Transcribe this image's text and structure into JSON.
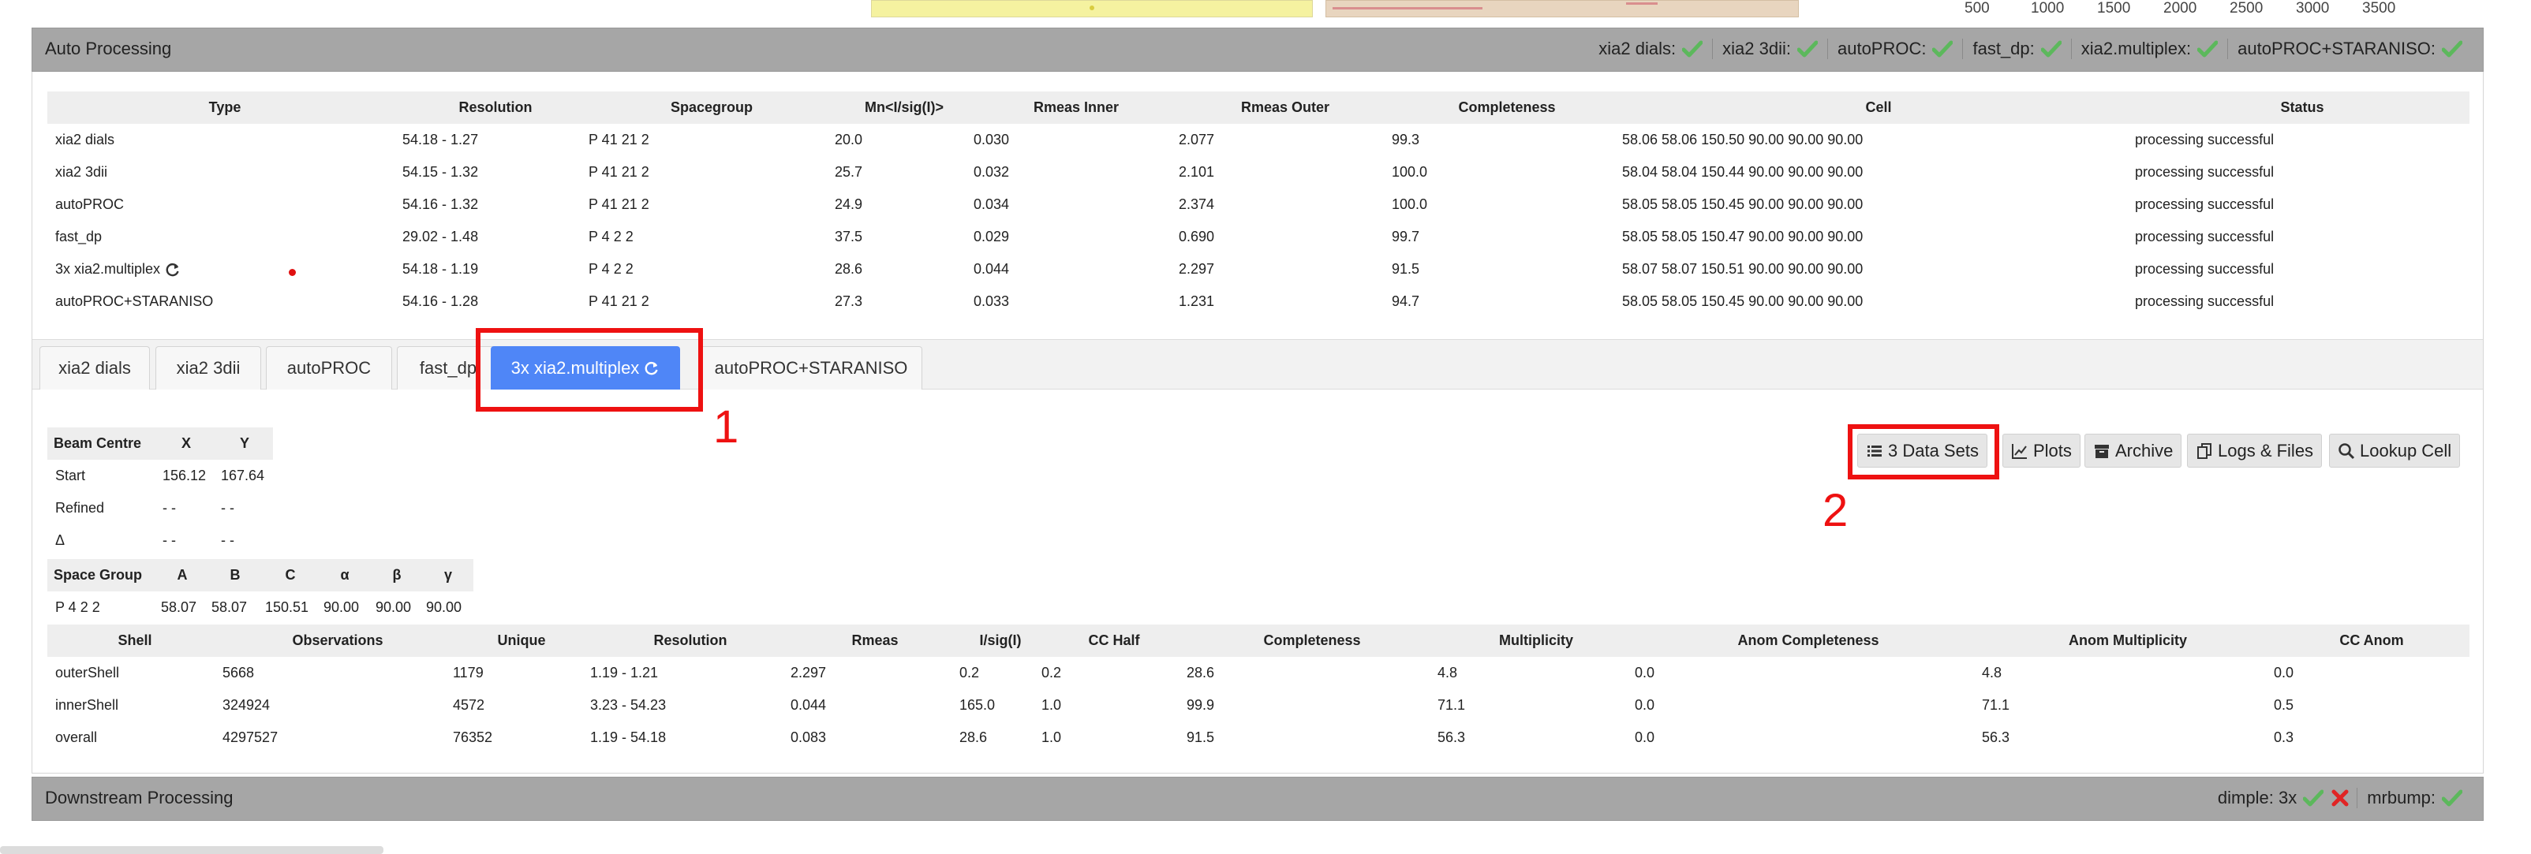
{
  "top_axis_ticks": [
    "500",
    "1000",
    "1500",
    "2000",
    "2500",
    "3000",
    "3500"
  ],
  "auto_processing": {
    "title": "Auto Processing",
    "statuses": [
      {
        "label": "xia2 dials:",
        "state": "success"
      },
      {
        "label": "xia2 3dii:",
        "state": "success"
      },
      {
        "label": "autoPROC:",
        "state": "success"
      },
      {
        "label": "fast_dp:",
        "state": "success"
      },
      {
        "label": "xia2.multiplex:",
        "state": "success"
      },
      {
        "label": "autoPROC+STARANISO:",
        "state": "success"
      }
    ],
    "columns": [
      "Type",
      "Resolution",
      "Spacegroup",
      "Mn<I/sig(I)>",
      "Rmeas Inner",
      "Rmeas Outer",
      "Completeness",
      "Cell",
      "Status"
    ],
    "rows": [
      {
        "type": "xia2 dials",
        "resolution": "54.18 - 1.27",
        "spacegroup": "P 41 21 2",
        "mn": "20.0",
        "rinner": "0.030",
        "router": "2.077",
        "completeness": "99.3",
        "cell": "58.06 58.06 150.50 90.00 90.00 90.00",
        "status": "processing successful"
      },
      {
        "type": "xia2 3dii",
        "resolution": "54.15 - 1.32",
        "spacegroup": "P 41 21 2",
        "mn": "25.7",
        "rinner": "0.032",
        "router": "2.101",
        "completeness": "100.0",
        "cell": "58.04 58.04 150.44 90.00 90.00 90.00",
        "status": "processing successful"
      },
      {
        "type": "autoPROC",
        "resolution": "54.16 - 1.32",
        "spacegroup": "P 41 21 2",
        "mn": "24.9",
        "rinner": "0.034",
        "router": "2.374",
        "completeness": "100.0",
        "cell": "58.05 58.05 150.45 90.00 90.00 90.00",
        "status": "processing successful"
      },
      {
        "type": "fast_dp",
        "resolution": "29.02 - 1.48",
        "spacegroup": "P 4 2 2",
        "mn": "37.5",
        "rinner": "0.029",
        "router": "0.690",
        "completeness": "99.7",
        "cell": "58.05 58.05 150.47 90.00 90.00 90.00",
        "status": "processing successful"
      },
      {
        "type": "3x xia2.multiplex",
        "resolution": "54.18 - 1.19",
        "spacegroup": "P 4 2 2",
        "mn": "28.6",
        "rinner": "0.044",
        "router": "2.297",
        "completeness": "91.5",
        "cell": "58.07 58.07 150.51 90.00 90.00 90.00",
        "status": "processing successful"
      },
      {
        "type": "autoPROC+STARANISO",
        "resolution": "54.16 - 1.28",
        "spacegroup": "P 41 21 2",
        "mn": "27.3",
        "rinner": "0.033",
        "router": "1.231",
        "completeness": "94.7",
        "cell": "58.05 58.05 150.45 90.00 90.00 90.00",
        "status": "processing successful"
      }
    ]
  },
  "tabs": [
    {
      "label": "xia2 dials",
      "active": false
    },
    {
      "label": "xia2 3dii",
      "active": false
    },
    {
      "label": "autoPROC",
      "active": false
    },
    {
      "label": "fast_dp",
      "active": false
    },
    {
      "label": "3x xia2.multiplex",
      "active": true
    },
    {
      "label": "autoPROC+STARANISO",
      "active": false
    }
  ],
  "annotations": {
    "one": "1",
    "two": "2"
  },
  "toolbar": {
    "datasets": "3 Data Sets",
    "plots": "Plots",
    "archive": "Archive",
    "logs": "Logs & Files",
    "lookup": "Lookup Cell"
  },
  "beam_centre": {
    "headers": [
      "Beam Centre",
      "X",
      "Y"
    ],
    "rows": [
      [
        "Start",
        "156.12",
        "167.64"
      ],
      [
        "Refined",
        "- -",
        "- -"
      ],
      [
        "Δ",
        "- -",
        "- -"
      ]
    ]
  },
  "space_group_table": {
    "headers": [
      "Space Group",
      "A",
      "B",
      "C",
      "α",
      "β",
      "γ"
    ],
    "row": [
      "P 4 2 2",
      "58.07",
      "58.07",
      "150.51",
      "90.00",
      "90.00",
      "90.00"
    ]
  },
  "shells": {
    "headers": [
      "Shell",
      "Observations",
      "Unique",
      "Resolution",
      "Rmeas",
      "I/sig(I)",
      "CC Half",
      "Completeness",
      "Multiplicity",
      "Anom Completeness",
      "Anom Multiplicity",
      "CC Anom"
    ],
    "rows": [
      [
        "outerShell",
        "5668",
        "1179",
        "1.19 - 1.21",
        "2.297",
        "0.2",
        "0.2",
        "28.6",
        "4.8",
        "0.0",
        "4.8",
        "0.0"
      ],
      [
        "innerShell",
        "324924",
        "4572",
        "3.23 - 54.23",
        "0.044",
        "165.0",
        "1.0",
        "99.9",
        "71.1",
        "0.0",
        "71.1",
        "0.5"
      ],
      [
        "overall",
        "4297527",
        "76352",
        "1.19 - 54.18",
        "0.083",
        "28.6",
        "1.0",
        "91.5",
        "56.3",
        "0.0",
        "56.3",
        "0.3"
      ]
    ]
  },
  "downstream": {
    "title": "Downstream Processing",
    "dimple_label": "dimple: 3x",
    "mrbump_label": "mrbump:"
  },
  "colors": {
    "success": "#5cb85c",
    "failure": "#e02424",
    "tab_active": "#4f86f7",
    "annotation": "#ee1111"
  }
}
